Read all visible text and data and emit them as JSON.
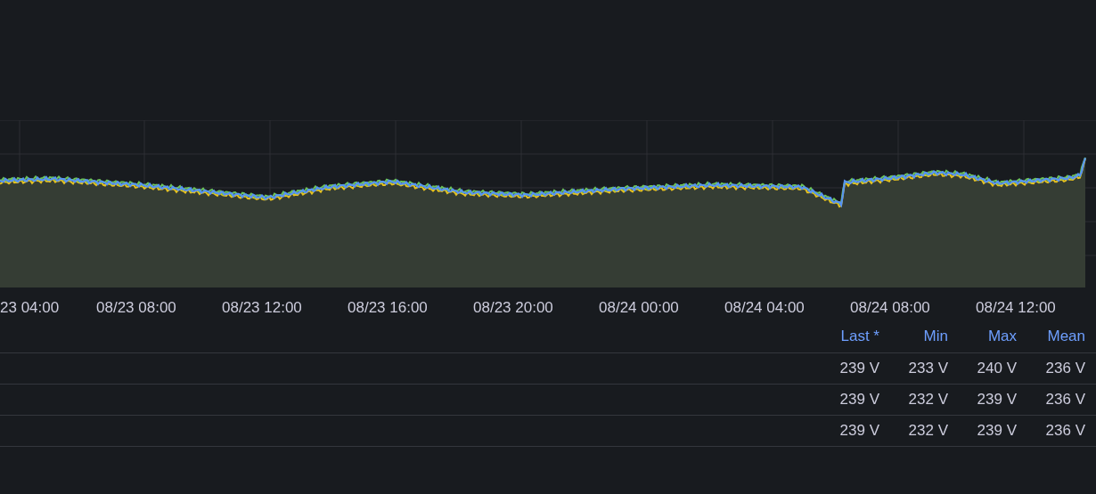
{
  "x_axis": {
    "tick_labels": [
      "23 04:00",
      "08/23 08:00",
      "08/23 12:00",
      "08/23 16:00",
      "08/23 20:00",
      "08/24 00:00",
      "08/24 04:00",
      "08/24 08:00",
      "08/24 12:00"
    ]
  },
  "legend": {
    "columns": [
      "Last *",
      "Min",
      "Max",
      "Mean"
    ],
    "rows": [
      [
        "239 V",
        "233 V",
        "240 V",
        "236 V"
      ],
      [
        "239 V",
        "232 V",
        "239 V",
        "236 V"
      ],
      [
        "239 V",
        "232 V",
        "239 V",
        "236 V"
      ]
    ]
  }
}
